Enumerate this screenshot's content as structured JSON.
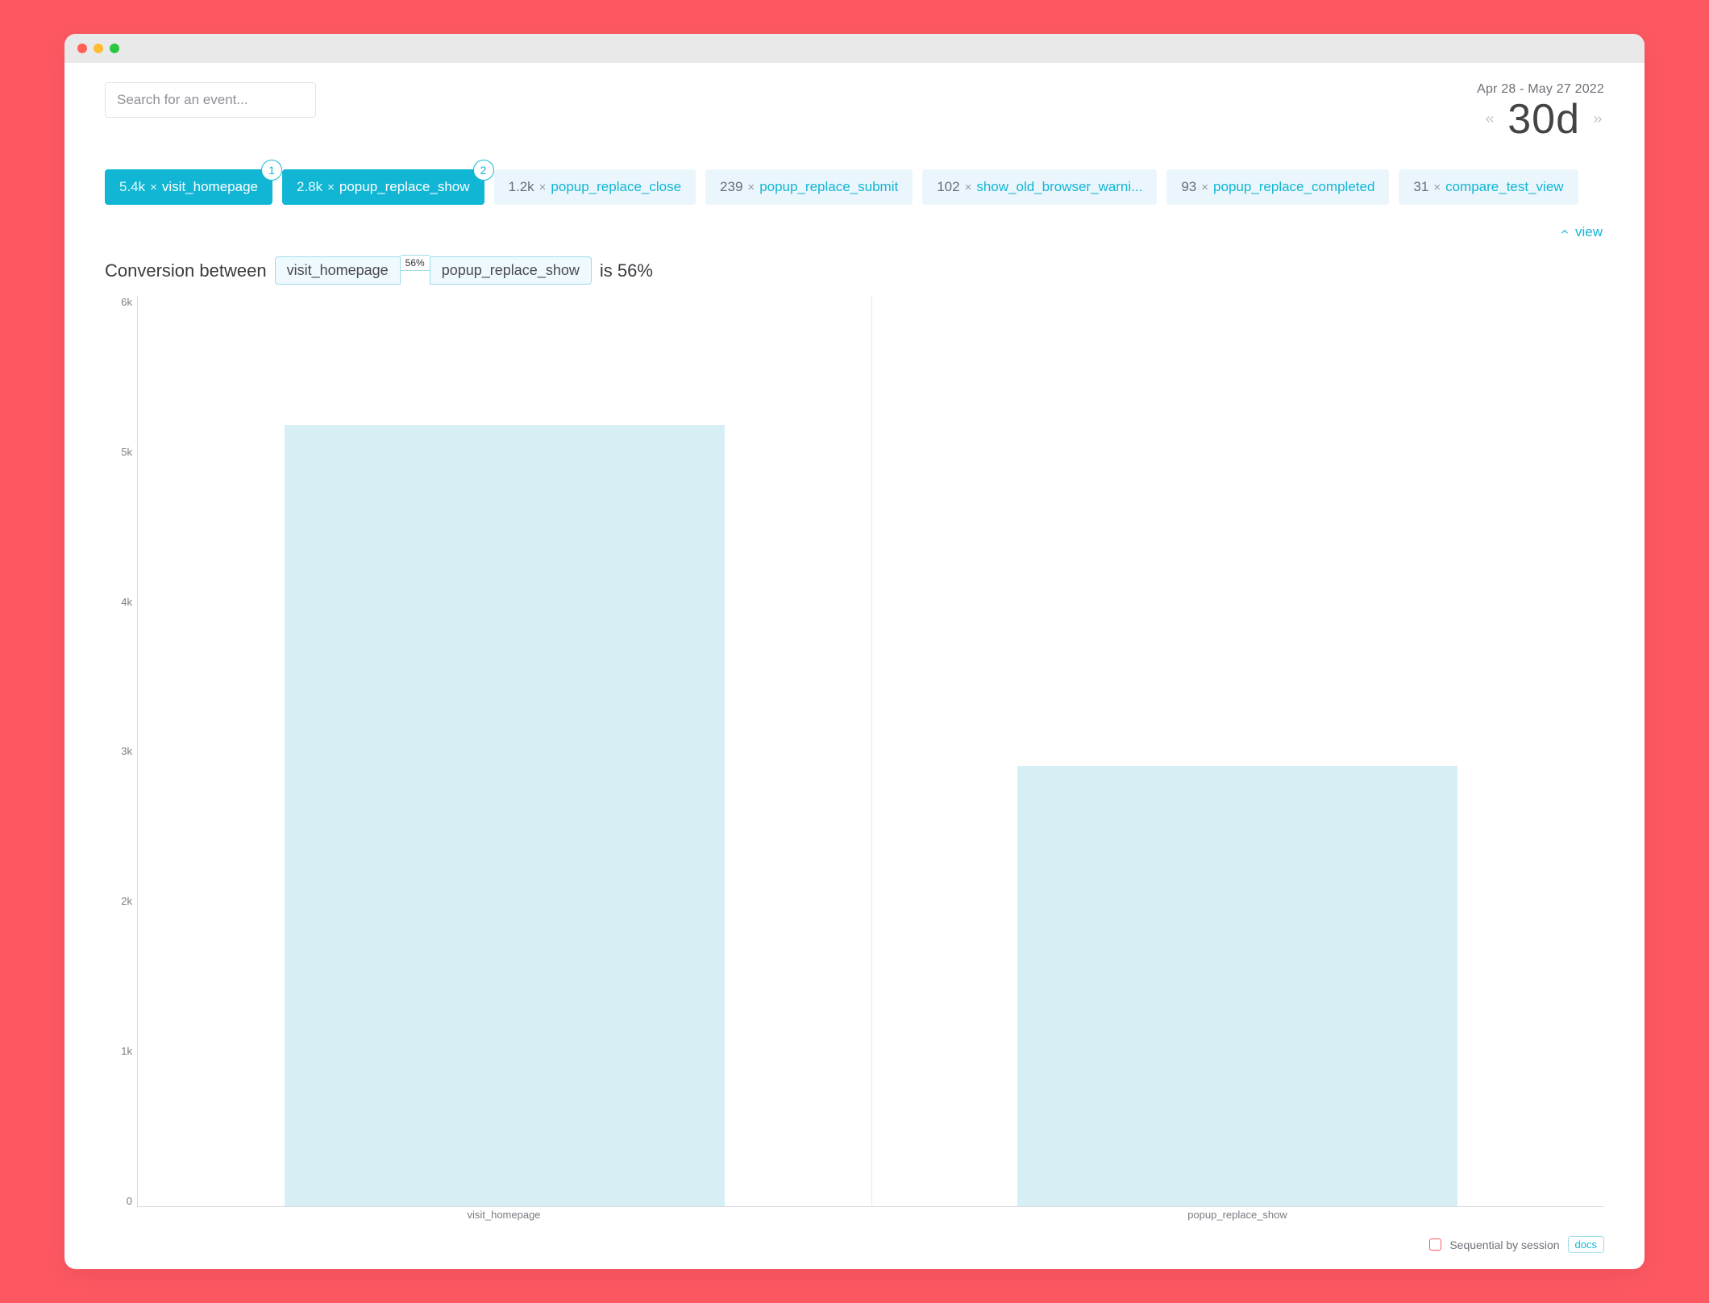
{
  "header": {
    "search_placeholder": "Search for an event...",
    "date_range": "Apr 28 - May 27 2022",
    "period_label": "30d"
  },
  "events": [
    {
      "count": "5.4k",
      "name": "visit_homepage",
      "selected": true,
      "order": 1
    },
    {
      "count": "2.8k",
      "name": "popup_replace_show",
      "selected": true,
      "order": 2
    },
    {
      "count": "1.2k",
      "name": "popup_replace_close",
      "selected": false
    },
    {
      "count": "239",
      "name": "popup_replace_submit",
      "selected": false
    },
    {
      "count": "102",
      "name": "show_old_browser_warni...",
      "selected": false
    },
    {
      "count": "93",
      "name": "popup_replace_completed",
      "selected": false
    },
    {
      "count": "31",
      "name": "compare_test_view",
      "selected": false
    }
  ],
  "view_link": "view",
  "conversion": {
    "prefix": "Conversion between",
    "from": "visit_homepage",
    "mid_pct": "56%",
    "to": "popup_replace_show",
    "suffix": "is 56%"
  },
  "footer": {
    "sequential_label": "Sequential by session",
    "docs_label": "docs"
  },
  "chart_data": {
    "type": "bar",
    "categories": [
      "visit_homepage",
      "popup_replace_show"
    ],
    "values": [
      5150,
      2900
    ],
    "title": "",
    "xlabel": "",
    "ylabel": "",
    "yticks": [
      "0",
      "1k",
      "2k",
      "3k",
      "4k",
      "5k",
      "6k"
    ],
    "ylim": [
      0,
      6000
    ]
  }
}
